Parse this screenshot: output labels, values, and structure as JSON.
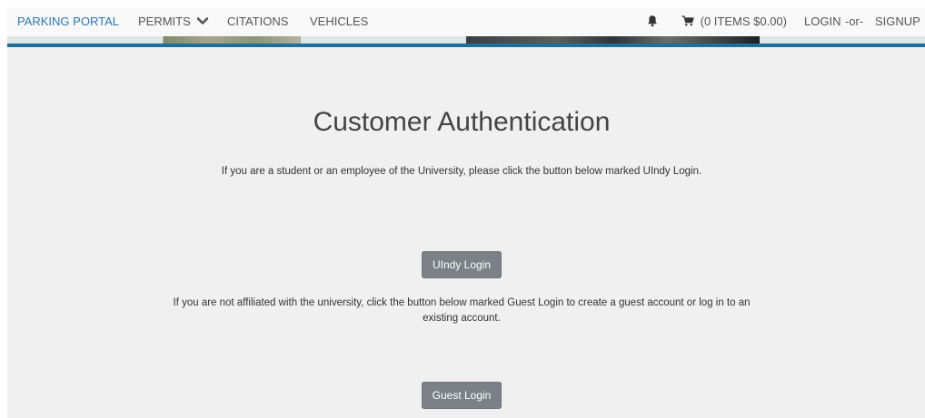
{
  "navbar": {
    "brand": "PARKING PORTAL",
    "permits": "PERMITS",
    "citations": "CITATIONS",
    "vehicles": "VEHICLES",
    "cart": "(0 ITEMS $0.00)",
    "login": "LOGIN",
    "or": "-or-",
    "signup": "SIGNUP"
  },
  "main": {
    "title": "Customer Authentication",
    "student_text": "If you are a student or an employee of the University, please click the button below marked UIndy Login.",
    "undy_button": "UIndy Login",
    "guest_text": "If you are not affiliated with the university, click the button below marked Guest Login to create a guest account or log in to an existing account.",
    "guest_button": "Guest Login"
  },
  "icons": {
    "permits_dropdown": "chevron-down-icon",
    "notifications": "bell-icon",
    "cart": "cart-icon"
  },
  "colors": {
    "brand": "#2b78b5",
    "accent_bar": "#1e6f9a",
    "button": "#7b8187",
    "background": "#f0f0f0"
  }
}
